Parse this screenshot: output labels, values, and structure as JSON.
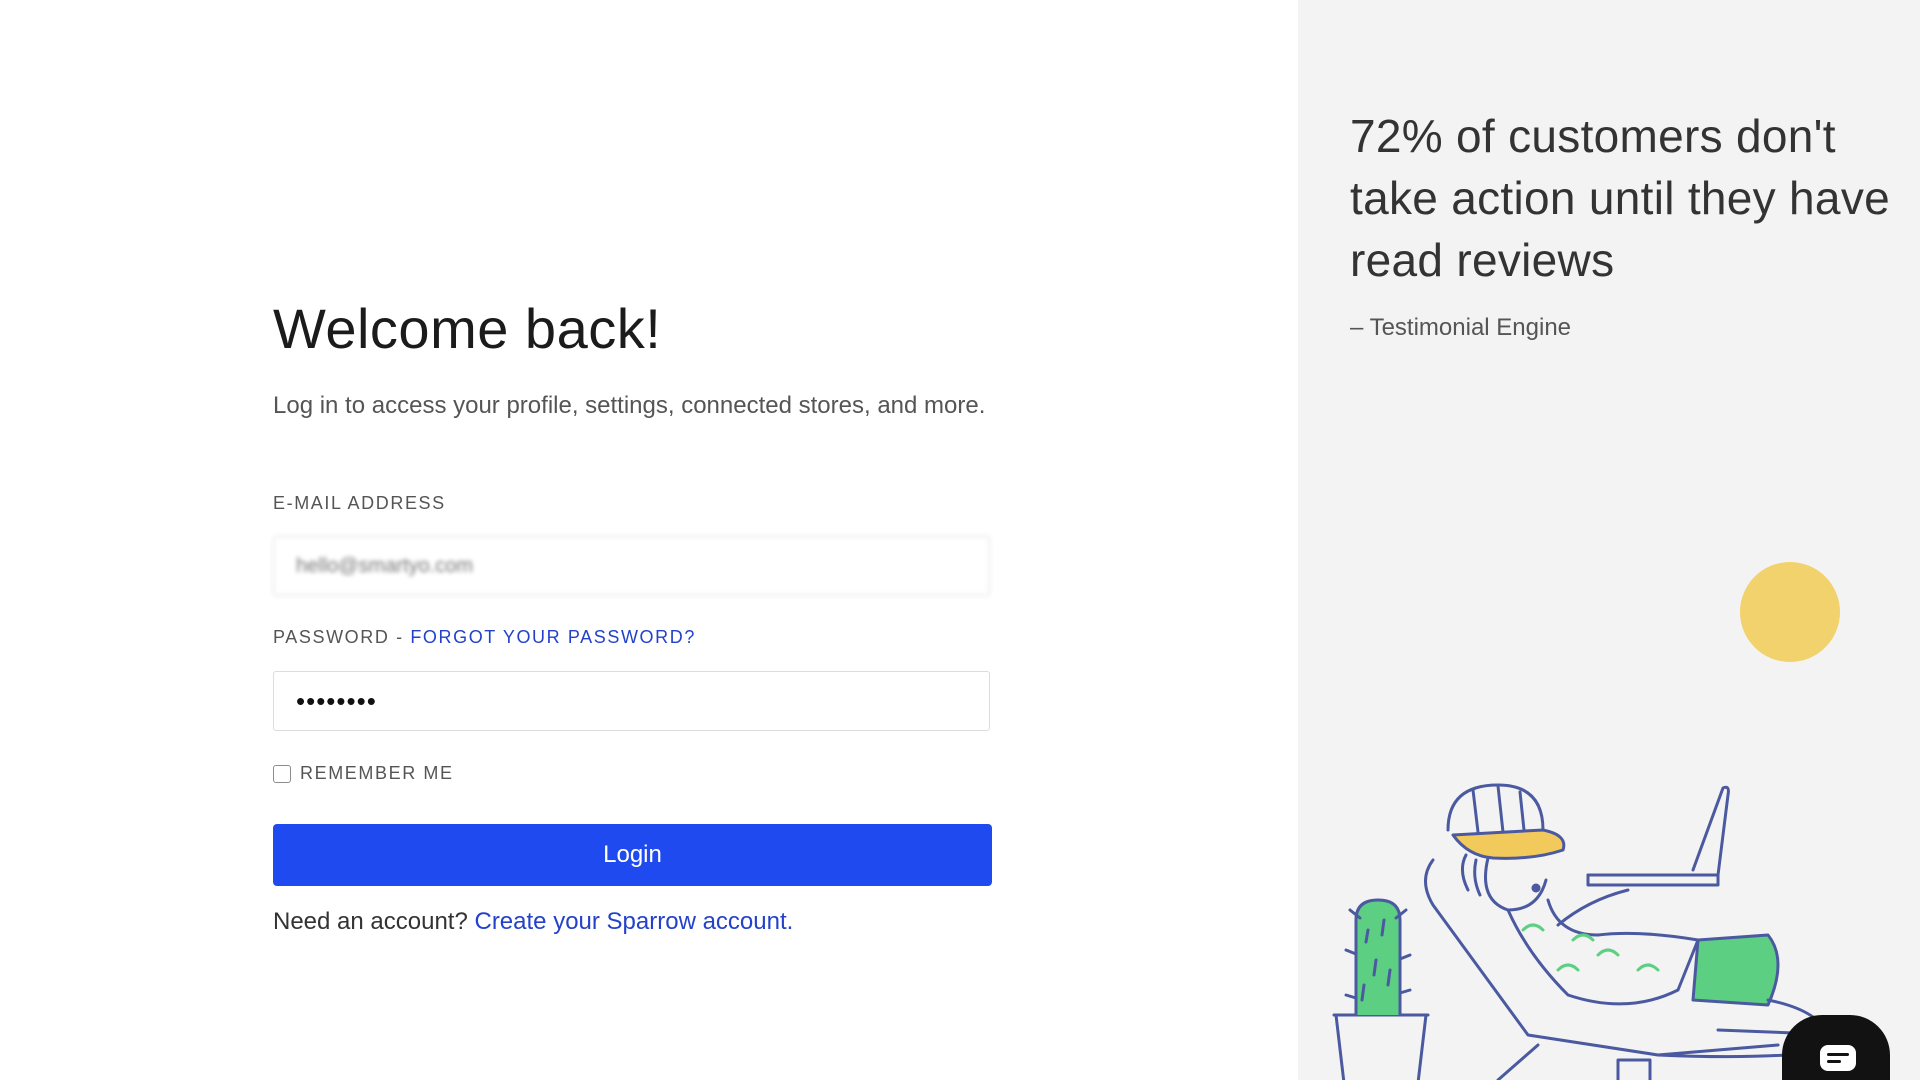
{
  "login": {
    "title": "Welcome back!",
    "subtitle": "Log in to access your profile, settings, connected stores, and more.",
    "email_label": "E-MAIL ADDRESS",
    "email_value": "hello@smartyo.com",
    "password_label": "PASSWORD",
    "password_separator": "-",
    "forgot_password_link": "FORGOT YOUR PASSWORD?",
    "password_value": "••••••••",
    "remember_me_label": "REMEMBER ME",
    "remember_me_checked": false,
    "login_button": "Login",
    "signup_prompt": "Need an account?",
    "signup_link": "Create your Sparrow account."
  },
  "testimonial": {
    "quote": "72% of customers don't take action until they have read reviews",
    "source": "– Testimonial Engine"
  },
  "colors": {
    "accent": "#1f4aef",
    "link": "#2342c9",
    "right_panel_bg": "#f3f3f3",
    "sun": "#f2d26c",
    "cactus": "#5ccf82",
    "shorts": "#5ccf82",
    "cap_brim": "#f2c95b",
    "line_art": "#4b5aa0",
    "chat_button": "#121212"
  },
  "icons": {
    "chat_widget": "chat-bubble-icon",
    "illustration": "man-relaxing-with-laptop-illustration"
  }
}
